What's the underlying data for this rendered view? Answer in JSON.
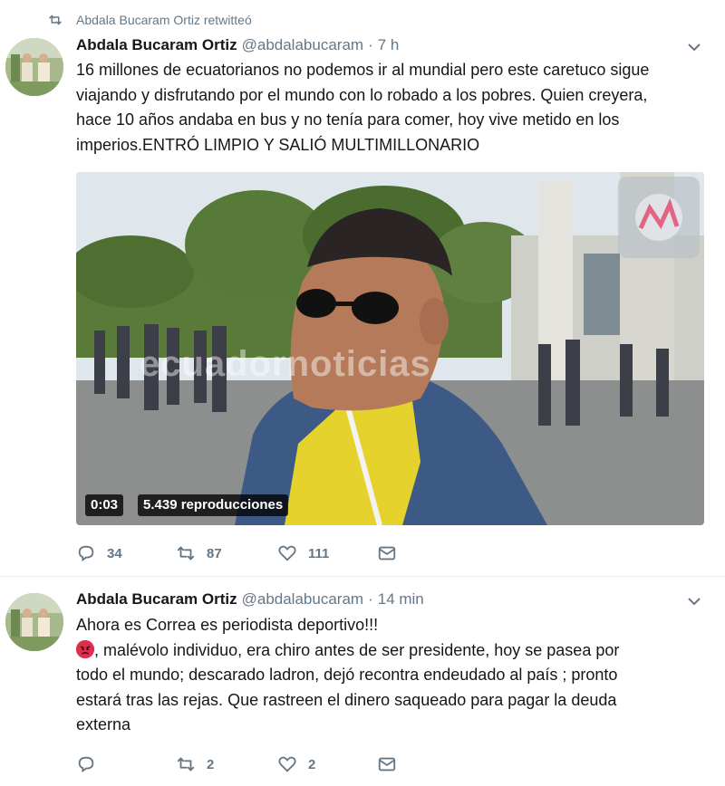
{
  "retweet": {
    "text": "Abdala Bucaram Ortiz retwitteó",
    "icon": "retweet-icon"
  },
  "tweets": [
    {
      "name": "Abdala Bucaram Ortiz",
      "handle": "@abdalabucaram",
      "separator": "·",
      "time": "7 h",
      "lines": [
        "16 millones de ecuatorianos no podemos ir al mundial pero este caretuco sigue",
        "viajando y disfrutando por el mundo con lo robado a los pobres. Quien creyera,",
        "hace 10 años andaba en bus y no tenía para comer, hoy vive metido en los",
        "imperios.ENTRÓ LIMPIO Y SALIÓ MULTIMILLONARIO"
      ],
      "video": {
        "duration": "0:03",
        "views": "5.439 reproducciones",
        "watermark": "ecuadornoticias"
      },
      "actions": {
        "replies": "34",
        "retweets": "87",
        "likes": "111"
      }
    },
    {
      "name": "Abdala Bucaram Ortiz",
      "handle": "@abdalabucaram",
      "separator": "·",
      "time": "14 min",
      "line1": "Ahora es Correa es periodista deportivo!!!",
      "line2_rest": ", malévolo individuo,  era chiro antes de ser presidente, hoy se pasea por",
      "lines": [
        "todo el mundo; descarado ladron, dejó recontra endeudado al país ; pronto",
        "estará tras las rejas. Que rastreen el dinero saqueado para pagar la deuda",
        "externa"
      ],
      "actions": {
        "replies": "",
        "retweets": "2",
        "likes": "2"
      }
    }
  ],
  "colors": {
    "text": "#14171a",
    "secondary": "#657786",
    "divider": "#e6ecf0",
    "angry_emoji": "#e02d4c"
  }
}
